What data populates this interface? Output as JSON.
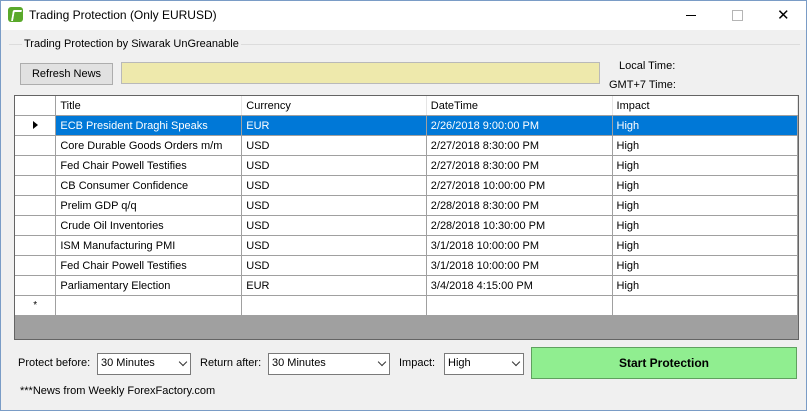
{
  "window": {
    "title": "Trading Protection (Only EURUSD)",
    "icon": "app-icon"
  },
  "group": {
    "label": "Trading Protection by Siwarak UnGreanable"
  },
  "toolbar": {
    "refresh_label": "Refresh News",
    "news_text": "",
    "news_box_color": "#eee9ac",
    "local_time_label": "Local Time:",
    "gmt_time_label": "GMT+7 Time:"
  },
  "grid": {
    "columns": [
      "Title",
      "Currency",
      "DateTime",
      "Impact"
    ],
    "rows": [
      [
        "ECB President Draghi Speaks",
        "EUR",
        "2/26/2018 9:00:00 PM",
        "High"
      ],
      [
        "Core Durable Goods Orders m/m",
        "USD",
        "2/27/2018 8:30:00 PM",
        "High"
      ],
      [
        "Fed Chair Powell Testifies",
        "USD",
        "2/27/2018 8:30:00 PM",
        "High"
      ],
      [
        "CB Consumer Confidence",
        "USD",
        "2/27/2018 10:00:00 PM",
        "High"
      ],
      [
        "Prelim GDP q/q",
        "USD",
        "2/28/2018 8:30:00 PM",
        "High"
      ],
      [
        "Crude Oil Inventories",
        "USD",
        "2/28/2018 10:30:00 PM",
        "High"
      ],
      [
        "ISM Manufacturing PMI",
        "USD",
        "3/1/2018 10:00:00 PM",
        "High"
      ],
      [
        "Fed Chair Powell Testifies",
        "USD",
        "3/1/2018 10:00:00 PM",
        "High"
      ],
      [
        "Parliamentary Election",
        "EUR",
        "3/4/2018 4:15:00 PM",
        "High"
      ]
    ],
    "selected_row": 0,
    "new_row_marker": "*",
    "selection_color": "#0078d7"
  },
  "controls": {
    "protect_before_label": "Protect before:",
    "protect_before_value": "30 Minutes",
    "return_after_label": "Return after:",
    "return_after_value": "30 Minutes",
    "impact_label": "Impact:",
    "impact_value": "High",
    "start_label": "Start Protection",
    "start_color": "#90ee90"
  },
  "footnote": "***News from Weekly ForexFactory.com"
}
